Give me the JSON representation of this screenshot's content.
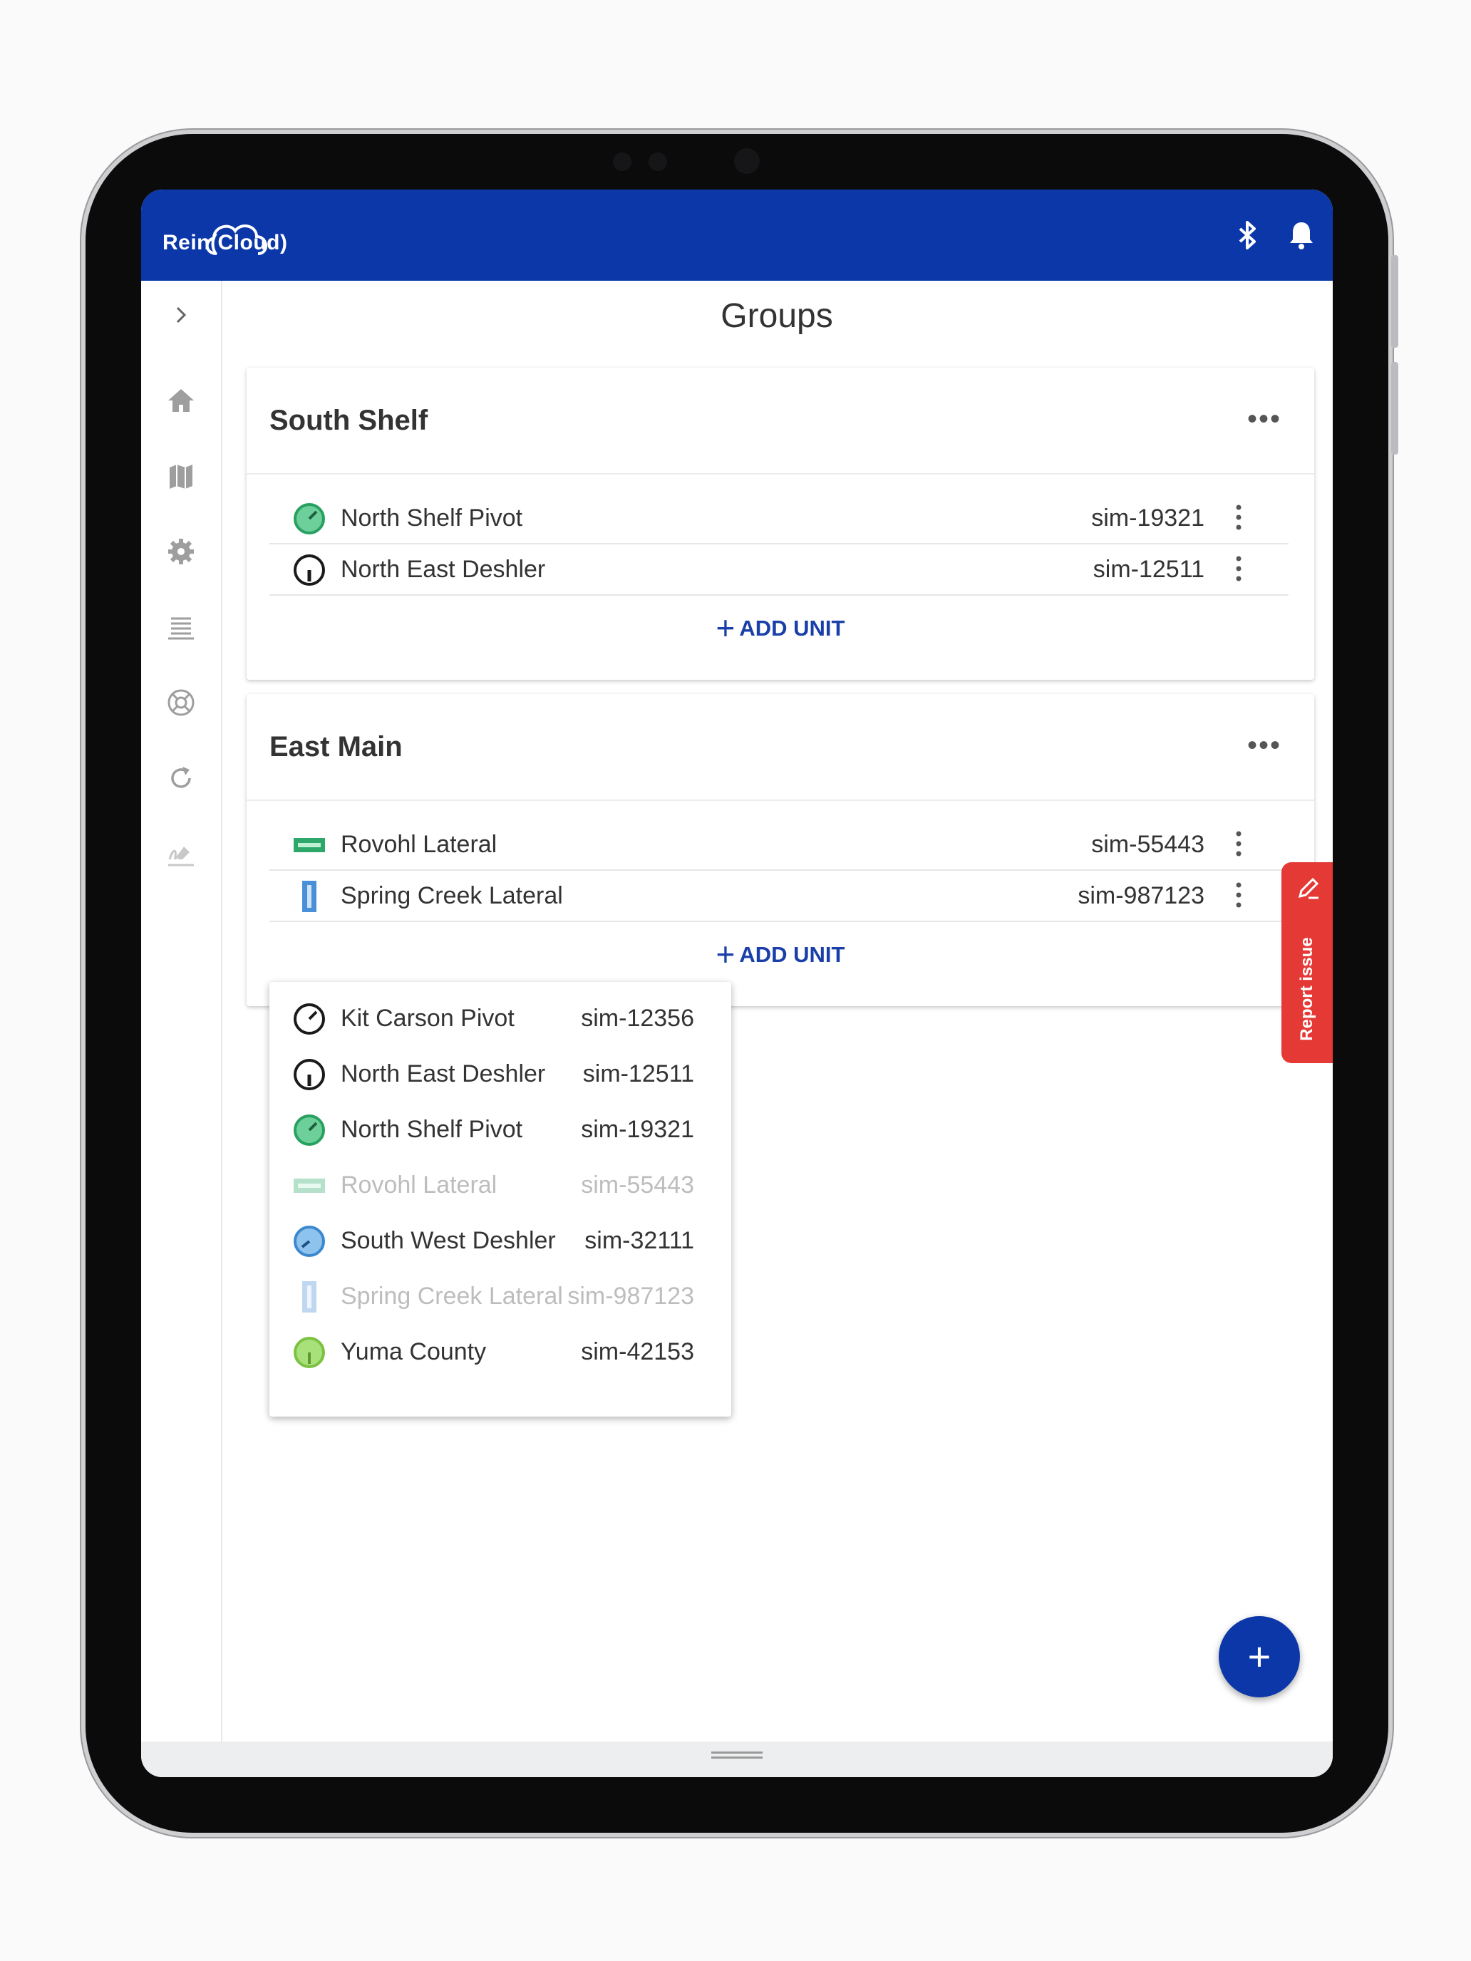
{
  "app": {
    "logo_text": "Rein(Cloud)",
    "brand_color": "#0b37a8",
    "icons": [
      "bluetooth-icon",
      "bell-icon"
    ]
  },
  "sidebar": {
    "expand_icon": "chevron-right-icon",
    "items": [
      {
        "icon": "home-icon"
      },
      {
        "icon": "map-icon"
      },
      {
        "icon": "gear-icon"
      },
      {
        "icon": "list-icon"
      },
      {
        "icon": "lifebuoy-icon"
      },
      {
        "icon": "refresh-icon"
      },
      {
        "icon": "signature-icon"
      }
    ]
  },
  "page": {
    "title": "Groups"
  },
  "groups": [
    {
      "name": "South Shelf",
      "more": "•••",
      "units": [
        {
          "name": "North Shelf Pivot",
          "sim": "sim-19321",
          "icon": "pivot-green-icon"
        },
        {
          "name": "North East Deshler",
          "sim": "sim-12511",
          "icon": "pivot-black-icon"
        }
      ],
      "add_label": "ADD UNIT"
    },
    {
      "name": "East Main",
      "more": "•••",
      "units": [
        {
          "name": "Rovohl Lateral",
          "sim": "sim-55443",
          "icon": "lateral-green-icon"
        },
        {
          "name": "Spring Creek Lateral",
          "sim": "sim-987123",
          "icon": "lateral-blue-icon"
        }
      ],
      "add_label": "ADD UNIT"
    }
  ],
  "dropdown": {
    "items": [
      {
        "name": "Kit Carson Pivot",
        "sim": "sim-12356",
        "icon": "pivot-black-icon",
        "disabled": false
      },
      {
        "name": "North East Deshler",
        "sim": "sim-12511",
        "icon": "pivot-black-icon",
        "disabled": false
      },
      {
        "name": "North Shelf Pivot",
        "sim": "sim-19321",
        "icon": "pivot-green-icon",
        "disabled": false
      },
      {
        "name": "Rovohl Lateral",
        "sim": "sim-55443",
        "icon": "lateral-green-icon",
        "disabled": true
      },
      {
        "name": "South West Deshler",
        "sim": "sim-32111",
        "icon": "pivot-blue-icon",
        "disabled": false
      },
      {
        "name": "Spring Creek Lateral",
        "sim": "sim-987123",
        "icon": "lateral-blue-icon",
        "disabled": true
      },
      {
        "name": "Yuma County",
        "sim": "sim-42153",
        "icon": "pivot-lime-icon",
        "disabled": false
      }
    ]
  },
  "report_issue": {
    "label": "Report issue",
    "color": "#e53935"
  },
  "fab": {
    "label": "+"
  }
}
